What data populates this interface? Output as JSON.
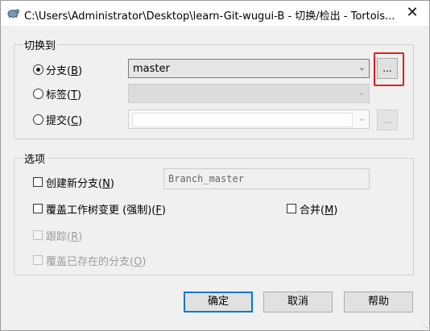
{
  "window": {
    "title": "C:\\Users\\Administrator\\Desktop\\learn-Git-wugui-B - 切换/检出 - Tortois...",
    "app_icon": "tortoise-git-icon",
    "close_label": "✕"
  },
  "switch_to": {
    "group_title": "切换到",
    "branch": {
      "label": "分支(",
      "mnemonic": "B",
      "suffix": ")",
      "selected": true,
      "value": "master"
    },
    "tag": {
      "label": "标签(",
      "mnemonic": "T",
      "suffix": ")",
      "selected": false,
      "value": ""
    },
    "commit": {
      "label": "提交(",
      "mnemonic": "C",
      "suffix": ")",
      "selected": false,
      "value": ""
    },
    "browse_label": "..."
  },
  "options": {
    "group_title": "选项",
    "create_branch": {
      "label": "创建新分支(",
      "mnemonic": "N",
      "suffix": ")",
      "checked": false,
      "value": "Branch_master"
    },
    "overwrite_changes": {
      "label": "覆盖工作树变更 (强制)(",
      "mnemonic": "F",
      "suffix": ")",
      "checked": false
    },
    "merge": {
      "label": "合并(",
      "mnemonic": "M",
      "suffix": ")",
      "checked": false
    },
    "track": {
      "label": "跟踪(",
      "mnemonic": "R",
      "suffix": ")",
      "checked": false,
      "disabled": true
    },
    "override_branch": {
      "label": "覆盖已存在的分支(",
      "mnemonic": "O",
      "suffix": ")",
      "checked": false,
      "disabled": true
    }
  },
  "buttons": {
    "ok": "确定",
    "cancel": "取消",
    "help": "帮助"
  },
  "colors": {
    "highlight": "#e02020",
    "default_button_border": "#0078d7"
  }
}
